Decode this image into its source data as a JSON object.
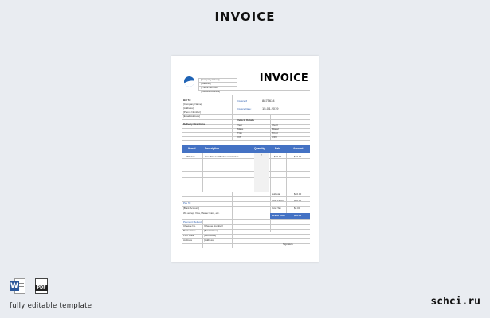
{
  "page": {
    "heading": "INVOICE",
    "caption": "fully editable template",
    "brand": "schci.ru"
  },
  "icons": {
    "word": "word-icon",
    "pdf": "pdf-icon",
    "pdf_label": "PDF",
    "word_letter": "W"
  },
  "invoice": {
    "title": "INVOICE",
    "company_lines": [
      "[Company Name]",
      "[Address]",
      "[Phone Number]",
      "[Website Address]"
    ],
    "bill_to": {
      "label": "Bill To:",
      "lines": [
        "[Company Name]",
        "[Address]",
        "[Phone Number]",
        "[Email Address]"
      ]
    },
    "invoice_no": {
      "label": "Invoice #",
      "value": "8875634"
    },
    "invoice_date": {
      "label": "Invoice Date:",
      "value": "15-04-2019"
    },
    "delivery_label": "Delivery Directions",
    "vehicle": {
      "label": "Vehicle Details",
      "fields": [
        {
          "key": "Year",
          "value": "[Year]"
        },
        {
          "key": "Make",
          "value": "[Make]"
        },
        {
          "key": "Trim",
          "value": "[Trim]"
        },
        {
          "key": "VIN",
          "value": "[VIN]"
        }
      ]
    },
    "table": {
      "headers": {
        "item": "Item #",
        "description": "Description",
        "qty": "Quantity",
        "rate": "Rate",
        "amount": "Amount"
      },
      "row": {
        "item": "Window",
        "description": "One-Trim In Window installation",
        "qty": "2",
        "rate": "$20.00",
        "amount": "$40.00"
      }
    },
    "totals": {
      "subtotal": {
        "label": "Subtotal",
        "value": "$40.00"
      },
      "total_labor": {
        "label": "Total Labor",
        "value": "$50.00"
      },
      "total_tax": {
        "label": "Total Tax",
        "value": "$2.00"
      },
      "grand_total": {
        "label": "Grand Total",
        "value": "$92.00"
      }
    },
    "pay_to": {
      "label": "Pay To:",
      "lines": [
        "[Bank Account]",
        "We accept Visa, Master Card, etc."
      ]
    },
    "payment": {
      "label": "Payment Method",
      "fields": [
        {
          "key": "Cheque No.",
          "value": "[Cheque Number]"
        },
        {
          "key": "Bank Name",
          "value": "[Bank Name]"
        },
        {
          "key": "PDC Date",
          "value": "[PDC Date]"
        },
        {
          "key": "Address",
          "value": "[Address]"
        }
      ]
    },
    "signature_label": "Signature"
  }
}
